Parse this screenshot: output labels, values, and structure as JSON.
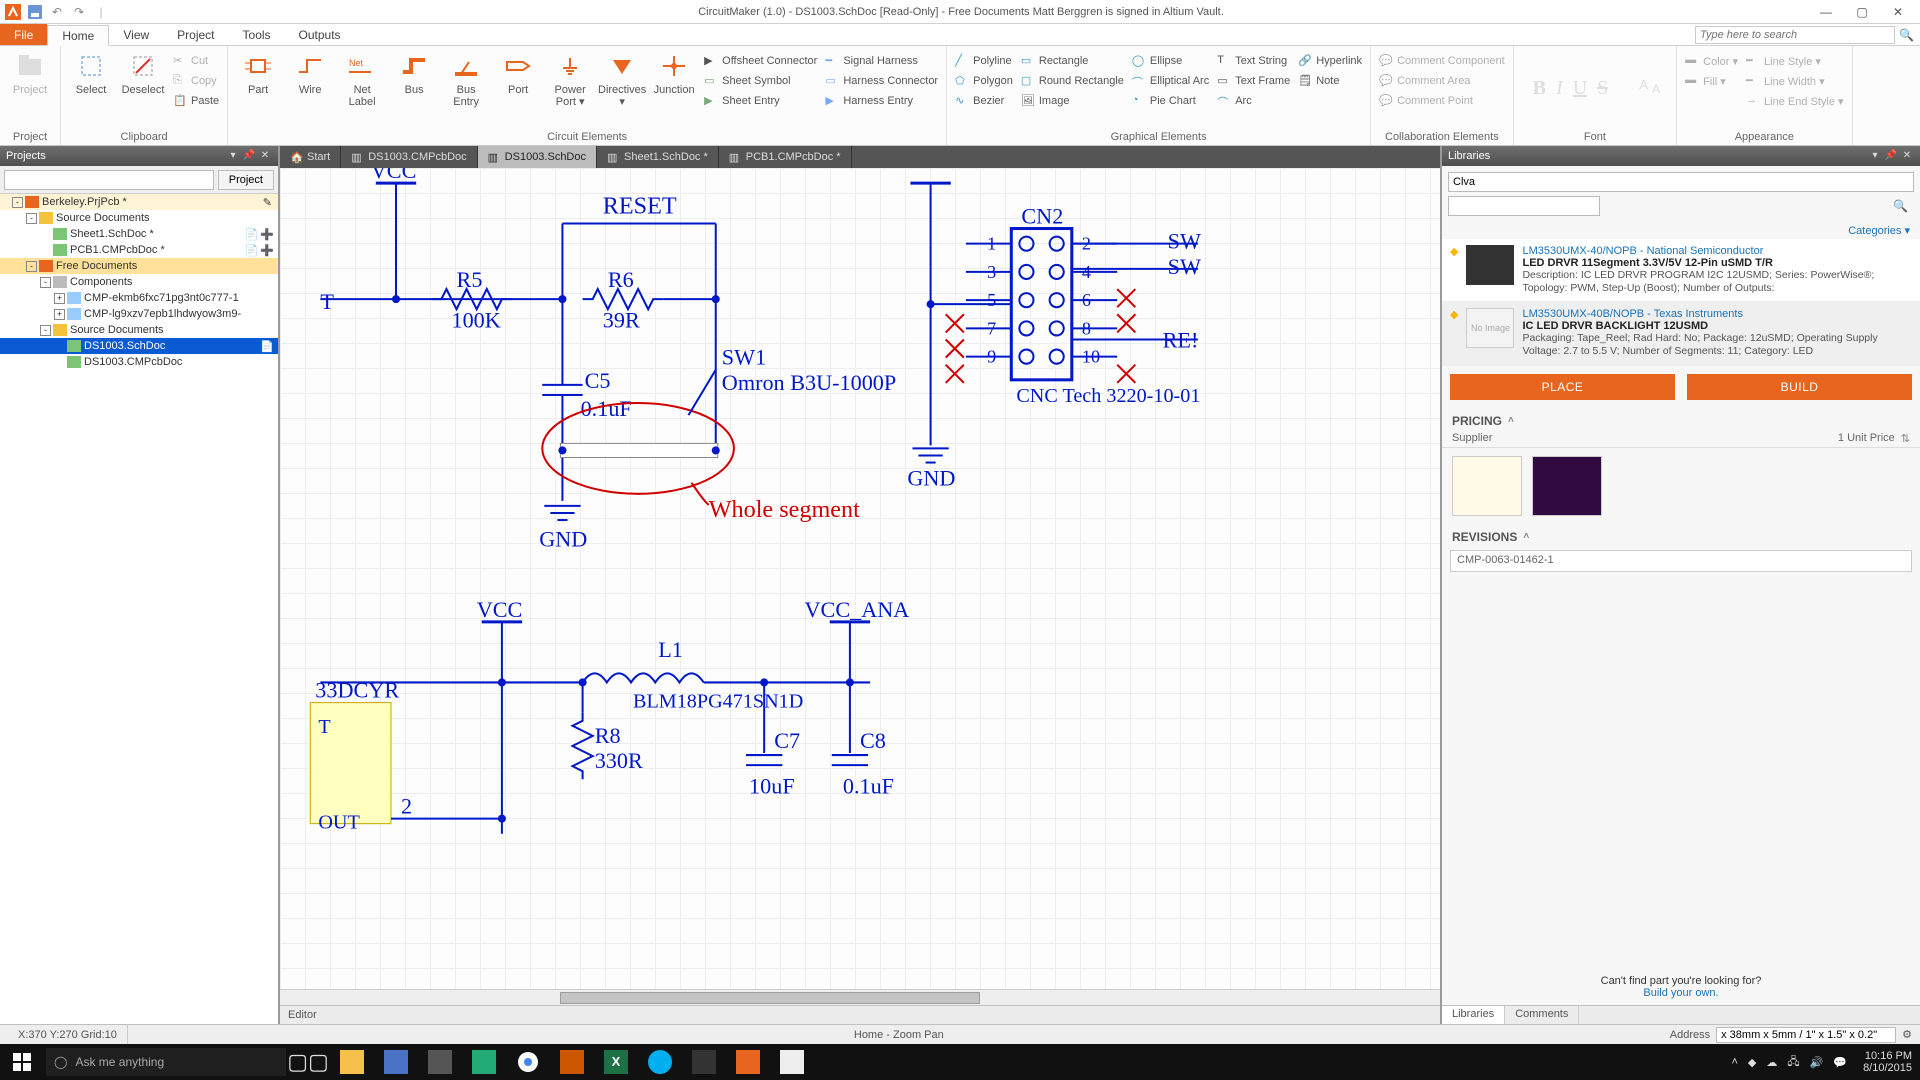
{
  "title": "CircuitMaker (1.0) - DS1003.SchDoc [Read-Only] - Free Documents  Matt Berggren is signed in Altium Vault.",
  "search_placeholder": "Type here to search",
  "menus": {
    "file": "File",
    "home": "Home",
    "view": "View",
    "project": "Project",
    "tools": "Tools",
    "outputs": "Outputs"
  },
  "ribbon": {
    "project": {
      "label": "Project",
      "project": "Project"
    },
    "clipboard": {
      "label": "Clipboard",
      "select": "Select",
      "deselect": "Deselect",
      "cut": "Cut",
      "copy": "Copy",
      "paste": "Paste"
    },
    "circuit": {
      "label": "Circuit Elements",
      "part": "Part",
      "wire": "Wire",
      "netlabel": "Net\nLabel",
      "bus": "Bus",
      "busentry": "Bus\nEntry",
      "port": "Port",
      "powerport": "Power\nPort ▾",
      "directives": "Directives\n▾",
      "junction": "Junction",
      "offsheet": "Offsheet Connector",
      "sheetsymbol": "Sheet Symbol",
      "sheetentry": "Sheet Entry",
      "signalharness": "Signal Harness",
      "harnessconnector": "Harness Connector",
      "harnessentry": "Harness Entry"
    },
    "graphical": {
      "label": "Graphical Elements",
      "polyline": "Polyline",
      "polygon": "Polygon",
      "bezier": "Bezier",
      "rectangle": "Rectangle",
      "roundrect": "Round Rectangle",
      "image": "Image",
      "ellipse": "Ellipse",
      "elliparc": "Elliptical Arc",
      "pie": "Pie Chart",
      "textstring": "Text String",
      "textframe": "Text Frame",
      "arc": "Arc",
      "hyperlink": "Hyperlink",
      "note": "Note"
    },
    "collab": {
      "label": "Collaboration Elements",
      "ccomp": "Comment Component",
      "carea": "Comment Area",
      "cpoint": "Comment Point"
    },
    "font": {
      "label": "Font"
    },
    "appearance": {
      "label": "Appearance",
      "color": "Color ▾",
      "fill": "Fill ▾",
      "linestyle": "Line Style ▾",
      "linewidth": "Line Width ▾",
      "lineend": "Line End Style ▾"
    }
  },
  "projects_panel": {
    "title": "Projects",
    "project_btn": "Project",
    "tree": [
      {
        "depth": 0,
        "exp": "-",
        "icon": "folder-orange",
        "text": "Berkeley.PrjPcb *",
        "status": [
          "pencil",
          "green"
        ],
        "cls": "sel"
      },
      {
        "depth": 1,
        "exp": "-",
        "icon": "folder-yellow",
        "text": "Source Documents"
      },
      {
        "depth": 2,
        "icon": "doc-green",
        "text": "Sheet1.SchDoc *",
        "status": [
          "open",
          "plus"
        ]
      },
      {
        "depth": 2,
        "icon": "doc-green",
        "text": "PCB1.CMPcbDoc *",
        "status": [
          "open",
          "plus"
        ]
      },
      {
        "depth": 1,
        "exp": "-",
        "icon": "folder-orange",
        "text": "Free Documents",
        "cls": "hl"
      },
      {
        "depth": 2,
        "exp": "-",
        "icon": "folder-grey",
        "text": "Components"
      },
      {
        "depth": 3,
        "exp": "+",
        "icon": "comp",
        "text": "CMP-ekmb6fxc71pg3nt0c777-1"
      },
      {
        "depth": 3,
        "exp": "+",
        "icon": "comp",
        "text": "CMP-lg9xzv7epb1lhdwyow3m9-"
      },
      {
        "depth": 2,
        "exp": "-",
        "icon": "folder-yellow",
        "text": "Source Documents"
      },
      {
        "depth": 3,
        "icon": "doc-green",
        "text": "DS1003.SchDoc",
        "status": [
          "open"
        ],
        "cls": "active-file"
      },
      {
        "depth": 3,
        "icon": "doc-green",
        "text": "DS1003.CMPcbDoc"
      }
    ]
  },
  "doctabs": [
    {
      "icon": "home",
      "text": "Start"
    },
    {
      "icon": "doc",
      "text": "DS1003.CMPcbDoc"
    },
    {
      "icon": "doc",
      "text": "DS1003.SchDoc",
      "active": true
    },
    {
      "icon": "doc",
      "text": "Sheet1.SchDoc *"
    },
    {
      "icon": "doc",
      "text": "PCB1.CMPcbDoc *"
    }
  ],
  "editor_footer": "Editor",
  "schematic": {
    "vcc1": "VCC",
    "reset": "RESET",
    "r5": "R5",
    "r5v": "100K",
    "r6": "R6",
    "r6v": "39R",
    "c5": "C5",
    "c5v": "0.1uF",
    "sw1": "SW1",
    "sw1v": "Omron B3U-1000P",
    "gnd1": "GND",
    "annot": "Whole segment",
    "gnd2": "GND",
    "cn2": "CN2",
    "cn2part": "CNC Tech 3220-10-01",
    "pins": [
      "1",
      "2",
      "3",
      "4",
      "5",
      "6",
      "7",
      "8",
      "9",
      "10"
    ],
    "sw_r1": "SW",
    "sw_r2": "SW",
    "res_r": "RE!",
    "t_left": "T",
    "tdcyr": "33DCYR",
    "out": "OUT",
    "pin2": "2",
    "vcc2": "VCC",
    "vcc_ana": "VCC_ANA",
    "l1": "L1",
    "l1v": "BLM18PG471SN1D",
    "r8": "R8",
    "r8v": "330R",
    "c7": "C7",
    "c7v": "10uF",
    "c8": "C8",
    "c8v": "0.1uF"
  },
  "libraries": {
    "title": "Libraries",
    "query": "Clva",
    "categories": "Categories ▾",
    "items": [
      {
        "name": "LM3530UMX-40/NOPB - National Semiconductor",
        "sub": "LED DRVR 11Segment 3.3V/5V 12-Pin uSMD T/R",
        "desc": "Description: IC LED DRVR PROGRAM I2C 12USMD; Series: PowerWise®; Topology: PWM, Step-Up (Boost); Number of Outputs:"
      },
      {
        "name": "LM3530UMX-40B/NOPB - Texas Instruments",
        "sub": "IC LED DRVR BACKLIGHT 12USMD",
        "desc": "Packaging: Tape_Reel; Rad Hard: No; Package: 12uSMD; Operating Supply Voltage: 2.7 to 5.5 V; Number of Segments: 11; Category: LED",
        "sel": true,
        "noimg": true
      }
    ],
    "place": "PLACE",
    "build": "BUILD",
    "pricing": "PRICING",
    "supplier": "Supplier",
    "unitprice": "1  Unit Price",
    "revisions": "REVISIONS",
    "rev0": "CMP-0063-01462-1",
    "foot1": "Can't find part you're looking for?",
    "foot2": "Build your own.",
    "tab_lib": "Libraries",
    "tab_com": "Comments"
  },
  "status": {
    "coord": "X:370 Y:270  Grid:10",
    "mode": "Home - Zoom Pan",
    "address": "Address",
    "dim": "x 38mm x 5mm / 1\" x 1.5\" x 0.2\""
  },
  "taskbar": {
    "cortana": "Ask me anything",
    "time": "10:16 PM",
    "date": "8/10/2015"
  }
}
